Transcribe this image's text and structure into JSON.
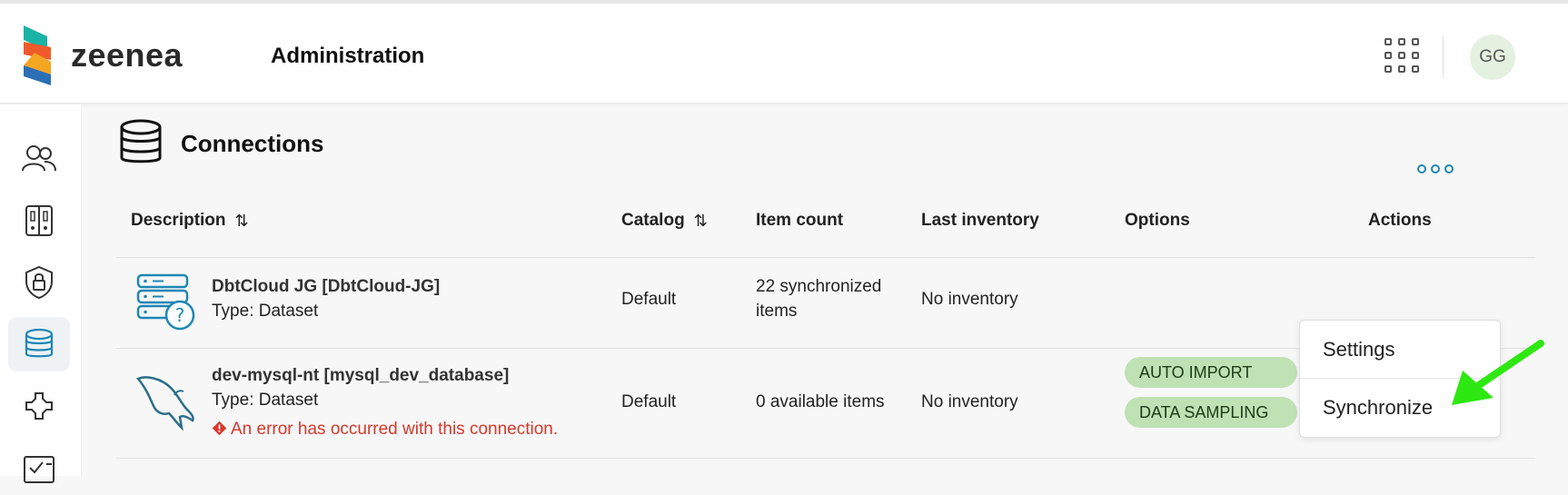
{
  "header": {
    "brand": "zeenea",
    "title": "Administration",
    "avatar_initials": "GG",
    "accent": "#1e87b5"
  },
  "sidebar": {
    "items": [
      {
        "name": "users",
        "icon": "users-icon",
        "active": false
      },
      {
        "name": "catalogs",
        "icon": "catalog-icon",
        "active": false
      },
      {
        "name": "security",
        "icon": "shield-lock-icon",
        "active": false
      },
      {
        "name": "connections",
        "icon": "database-icon",
        "active": true
      },
      {
        "name": "plugins",
        "icon": "puzzle-icon",
        "active": false
      },
      {
        "name": "tasks",
        "icon": "calendar-check-icon",
        "active": false
      }
    ]
  },
  "page": {
    "title": "Connections"
  },
  "table": {
    "columns": [
      "Description",
      "Catalog",
      "Item count",
      "Last inventory",
      "Options",
      "Actions"
    ],
    "rows": [
      {
        "name": "DbtCloud JG [DbtCloud-JG]",
        "type": "Type: Dataset",
        "catalog": "Default",
        "item_count_line1": "22 synchronized",
        "item_count_line2": "items",
        "last_inventory": "No inventory",
        "icon": "server-question-icon"
      },
      {
        "name": "dev-mysql-nt [mysql_dev_database]",
        "type": "Type: Dataset",
        "error": "An error has occurred with this connection.",
        "catalog": "Default",
        "item_count": "0 available items",
        "last_inventory": "No inventory",
        "options": [
          "AUTO IMPORT",
          "DATA SAMPLING"
        ],
        "icon": "mysql-dolphin-icon"
      }
    ]
  },
  "actions_menu": {
    "items": [
      "Settings",
      "Synchronize"
    ]
  },
  "annotation": {
    "arrow_color": "#2ee812"
  }
}
